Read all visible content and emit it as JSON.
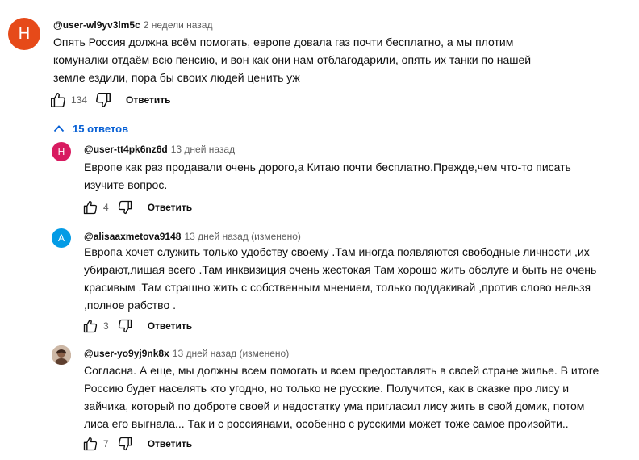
{
  "main_comment": {
    "avatar_letter": "Н",
    "avatar_color": "#e64a19",
    "author": "@user-wl9yv3lm5c",
    "time": "2 недели назад",
    "lines": [
      "Опять Россия должна всём помогать, европе довала газ почти бесплатно, а мы плотим",
      "комуналки отдаём всю пенсию, и вон как они нам отблагодарили, опять их танки по нашей",
      "земле ездили, пора бы своих людей ценить уж"
    ],
    "likes": "134",
    "reply_label": "Ответить"
  },
  "replies_toggle": {
    "label": "15 ответов",
    "accent_color": "#065fd4"
  },
  "replies": [
    {
      "avatar_letter": "Н",
      "avatar_color": "#d81b60",
      "author": "@user-tt4pk6nz6d",
      "time": "13 дней назад",
      "lines": [
        "Европе как раз продавали очень дорого,а Китаю почти бесплатно.Прежде,чем что-то писать",
        "изучите вопрос."
      ],
      "likes": "4",
      "reply_label": "Ответить"
    },
    {
      "avatar_letter": "A",
      "avatar_color": "#039be5",
      "author": "@alisaaxmetova9148",
      "time": "13 дней назад (изменено)",
      "lines": [
        "Европа хочет служить только удобству своему .Там иногда появляются свободные личности ,их",
        "убирают,лишая всего .Там инквизиция очень жестокая Там хорошо жить обслуге и быть не очень",
        "красивым .Там страшно жить с собственным мнением, только поддакивай ,против слово нельзя",
        ",полное рабство ."
      ],
      "likes": "3",
      "reply_label": "Ответить"
    },
    {
      "avatar_letter": "",
      "avatar_color": "#b08c72",
      "author": "@user-yo9yj9nk8x",
      "time": "13 дней назад (изменено)",
      "lines": [
        "Согласна. А еще, мы должны всем помогать и всем предоставлять  в своей стране жилье. В итоге",
        "Россию будет населять кто угодно, но только не русские. Получится, как в сказке про лису и",
        "зайчика, который по доброте своей и недостатку  ума пригласил лису жить в свой домик, потом",
        "лиса его выгнала... Так и с россиянами, особенно с  русскими может тоже самое произойти.."
      ],
      "likes": "7",
      "reply_label": "Ответить"
    }
  ]
}
